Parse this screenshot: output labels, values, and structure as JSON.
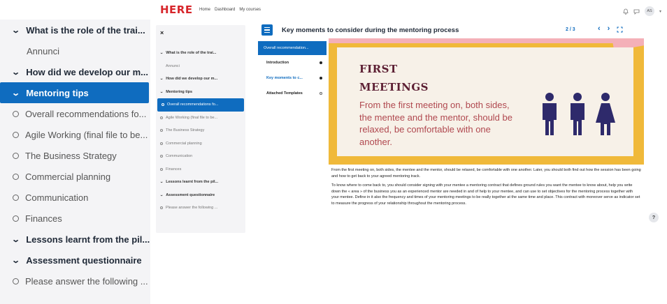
{
  "big_sidebar": {
    "items": [
      {
        "label": "What is the role of the trai...",
        "kind": "section"
      },
      {
        "label": "Annunci",
        "kind": "sub"
      },
      {
        "label": "How did we develop our m...",
        "kind": "section"
      },
      {
        "label": "Mentoring tips",
        "kind": "section",
        "active": true
      },
      {
        "label": "Overall recommendations fo...",
        "kind": "plain"
      },
      {
        "label": "Agile Working (final file to be...",
        "kind": "plain"
      },
      {
        "label": "The Business Strategy",
        "kind": "plain"
      },
      {
        "label": "Commercial planning",
        "kind": "plain"
      },
      {
        "label": "Communication",
        "kind": "plain"
      },
      {
        "label": "Finances",
        "kind": "plain"
      },
      {
        "label": "Lessons learnt from the pil...",
        "kind": "section"
      },
      {
        "label": "Assessment questionnaire",
        "kind": "section"
      },
      {
        "label": "Please answer the following ...",
        "kind": "plain"
      }
    ]
  },
  "topbar": {
    "logo": "HERE",
    "nav": [
      "Home",
      "Dashboard",
      "My courses"
    ],
    "avatar": "AS",
    "icons": [
      "bell-icon",
      "chat-icon",
      "chevron-down-icon"
    ]
  },
  "small_drawer": {
    "close": "×",
    "items": [
      {
        "label": "What is the role of the trai...",
        "kind": "section"
      },
      {
        "label": "Annunci",
        "kind": "sub"
      },
      {
        "label": "How did we develop our m...",
        "kind": "section"
      },
      {
        "label": "Mentoring tips",
        "kind": "section"
      },
      {
        "label": "Overall recommendations fo...",
        "kind": "plain",
        "active": true
      },
      {
        "label": "Agile Working (final file to be...",
        "kind": "plain"
      },
      {
        "label": "The Business Strategy",
        "kind": "plain"
      },
      {
        "label": "Commercial planning",
        "kind": "plain"
      },
      {
        "label": "Communication",
        "kind": "plain"
      },
      {
        "label": "Finances",
        "kind": "plain"
      },
      {
        "label": "Lessons learnt from the pil...",
        "kind": "section"
      },
      {
        "label": "Assessment questionnaire",
        "kind": "section"
      },
      {
        "label": "Please answer the following ...",
        "kind": "plain"
      }
    ]
  },
  "lesson": {
    "title": "Key moments to consider during the mentoring process",
    "page": "2 / 3",
    "menu": [
      {
        "label": "Overall recommendation...",
        "state": "active"
      },
      {
        "label": "Introduction",
        "state": "done"
      },
      {
        "label": "Key moments to c...",
        "state": "current"
      },
      {
        "label": "Attached Templates",
        "state": "todo"
      }
    ],
    "slide": {
      "heading1": "FIRST",
      "heading2": "MEETINGS",
      "text": "From the first meeting on, both sides, the mentee and the mentor, should be relaxed, be comfortable with one another."
    },
    "body": [
      "From the first meeting on, both sides, the mentee and the mentor, should be relaxed, be comfortable with one another. Later, you should both find out how the session has been going and how to get back to your agreed mentoring track.",
      "To know where to come back to, you should consider signing with your mentee a mentoring contract that defines ground rules you want the mentee to know about, help you write down the « area » of the business you as an experienced mentor are needed in and of help to your mentee, and can use to set objectives for the mentoring process together with your mentee. Define in it also the frequency and times of your mentoring meetings to be really together at the same time and place. This contract with moreover serve as indicator set to measure the progress of your relationship throughout the mentoring process."
    ]
  },
  "help": "?",
  "colors": {
    "primary": "#0f6cbf",
    "slide_yellow": "#f0b93a",
    "slide_title": "#5c1f33",
    "slide_text": "#b0484f",
    "figures": "#2e2a6b",
    "brand": "#d7262b"
  }
}
